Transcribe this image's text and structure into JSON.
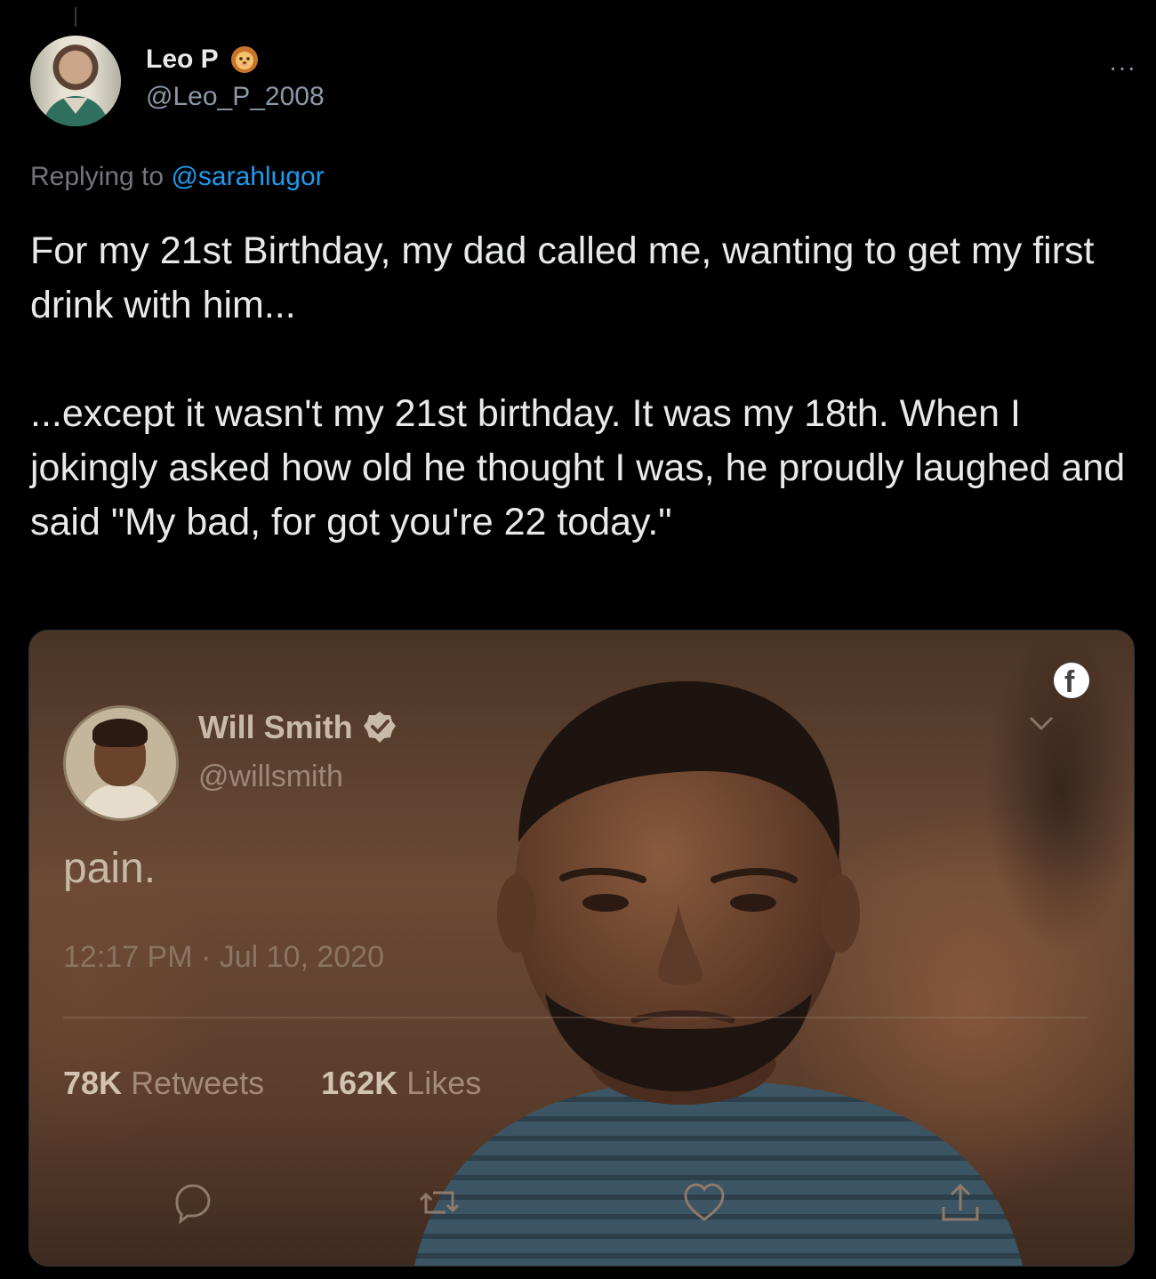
{
  "author": {
    "display_name": "Leo P",
    "badge_icon": "lion-emoji-icon",
    "handle": "@Leo_P_2008"
  },
  "reply": {
    "prefix": "Replying to",
    "mention": "@sarahlugor"
  },
  "tweet": {
    "paragraph_1": "For my 21st Birthday, my dad called me, wanting to get my first drink with him...",
    "paragraph_2": "...except it wasn't my 21st birthday. It was my 18th. When I jokingly asked how old he thought I was, he proudly laughed and said \"My bad, for got you're 22 today.\""
  },
  "media": {
    "embedded_tweet": {
      "name": "Will Smith",
      "handle": "@willsmith",
      "text": "pain.",
      "timestamp": "12:17 PM · Jul 10, 2020",
      "retweets_count": "78K",
      "retweets_label": "Retweets",
      "likes_count": "162K",
      "likes_label": "Likes"
    },
    "watermark_icon": "facebook-icon"
  },
  "colors": {
    "background": "#000000",
    "text": "#e7e9ea",
    "secondary": "#71767b",
    "link": "#1d9bf0"
  }
}
